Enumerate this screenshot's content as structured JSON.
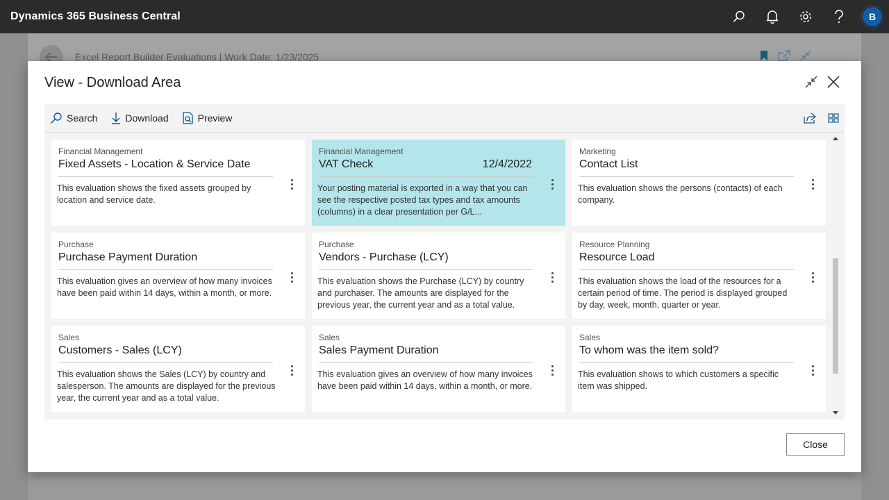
{
  "app": {
    "title": "Dynamics 365 Business Central",
    "avatar_initial": "B"
  },
  "background_page": {
    "title": "Excel Report Builder Evaluations | Work Date: 1/23/2025"
  },
  "dialog": {
    "title": "View - Download Area",
    "actions": {
      "search": "Search",
      "download": "Download",
      "preview": "Preview"
    },
    "close_label": "Close"
  },
  "cards": [
    {
      "category": "Financial Management",
      "title": "Fixed Assets - Location & Service Date",
      "date": "",
      "description": "This evaluation shows the fixed assets grouped by location and service date.",
      "selected": false
    },
    {
      "category": "Financial Management",
      "title": "VAT Check",
      "date": "12/4/2022",
      "description": "Your posting material is exported in a way that you can see the respective posted tax types and tax amounts (columns) in a clear presentation per G/L...",
      "selected": true
    },
    {
      "category": "Marketing",
      "title": "Contact List",
      "date": "",
      "description": "This evaluation shows the persons (contacts) of each company.",
      "selected": false
    },
    {
      "category": "Purchase",
      "title": "Purchase Payment Duration",
      "date": "",
      "description": "This evaluation gives an overview of how many invoices have been paid within 14 days, within a month, or more.",
      "selected": false
    },
    {
      "category": "Purchase",
      "title": "Vendors - Purchase (LCY)",
      "date": "",
      "description": "This evaluation shows the Purchase (LCY) by country and purchaser. The amounts are displayed for the previous year, the current year and as a total value.",
      "selected": false
    },
    {
      "category": "Resource Planning",
      "title": "Resource Load",
      "date": "",
      "description": "This evaluation shows the load of the resources for a certain period of time. The period is displayed grouped by day, week, month, quarter or year.",
      "selected": false
    },
    {
      "category": "Sales",
      "title": "Customers - Sales (LCY)",
      "date": "",
      "description": "This evaluation shows the Sales (LCY) by country and salesperson. The amounts are displayed for the previous year, the current year and as a total value.",
      "selected": false
    },
    {
      "category": "Sales",
      "title": "Sales Payment Duration",
      "date": "",
      "description": "This evaluation gives an overview of how many invoices have been paid within 14 days, within a month, or more.",
      "selected": false
    },
    {
      "category": "Sales",
      "title": "To whom was the item sold?",
      "date": "",
      "description": "This evaluation shows to which customers a specific item was shipped.",
      "selected": false
    }
  ],
  "colors": {
    "appbar": "#2b2b2b",
    "selected_card": "#b3e5ea",
    "avatar": "#0f5ea8"
  }
}
